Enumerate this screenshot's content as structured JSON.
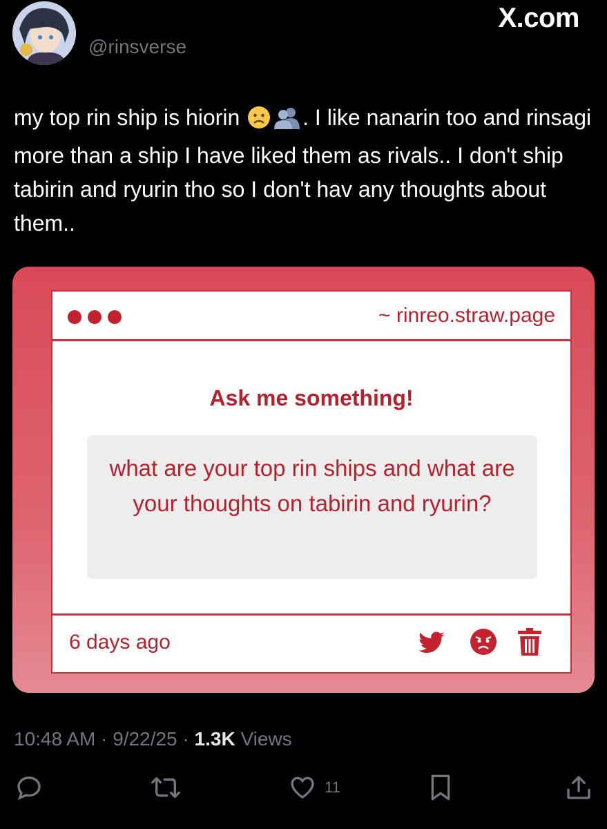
{
  "header": {
    "handle": "@rinsverse",
    "brand": "X.com"
  },
  "tweet": {
    "text_before_emoji": "my top rin ship is hiorin ",
    "emoji_1": "slightly-frowning-face-emoji",
    "emoji_2": "people-silhouette-emoji",
    "text_after_emoji": ". I like nanarin too and rinsagi more than a ship I have liked them as rivals.. I don't ship tabirin and ryurin tho so I don't hav any thoughts about them.."
  },
  "card": {
    "url": "~ rinreo.straw.page",
    "title": "Ask me something!",
    "question": "what are your top rin ships and what are your thoughts on tabirin and ryurin?",
    "time_ago": "6 days ago",
    "icons": [
      "twitter-bird-icon",
      "angry-face-icon",
      "trash-icon"
    ]
  },
  "meta": {
    "time": "10:48 AM",
    "sep1": " · ",
    "date": "9/22/25",
    "sep2": " · ",
    "views_count": "1.3K",
    "views_label": " Views"
  },
  "actions": {
    "like_count": "11"
  },
  "colors": {
    "background": "#000000",
    "card_red": "#d94a58",
    "accent_red": "#b5222e",
    "muted": "#71767b"
  }
}
